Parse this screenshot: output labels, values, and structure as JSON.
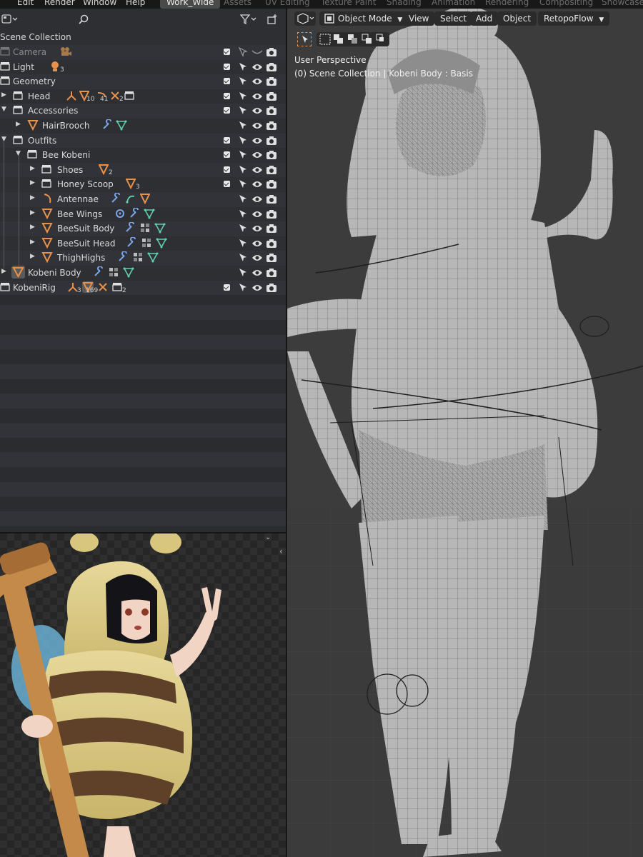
{
  "menubar": {
    "menus": [
      "Edit",
      "Render",
      "Window",
      "Help"
    ],
    "workspaces": [
      "Work_Wide",
      "Assets",
      "UV Editing",
      "Texture Paint",
      "Shading",
      "Animation",
      "Rendering",
      "Compositing",
      "Showcase"
    ],
    "active_workspace": "Work_Wide"
  },
  "outliner": {
    "root_label": "Scene Collection",
    "rows": [
      {
        "label": "Camera",
        "badge": ""
      },
      {
        "label": "Light",
        "badge": "3"
      },
      {
        "label": "Geometry",
        "badge": ""
      },
      {
        "label": "Head",
        "badge_a": "10",
        "badge_b": "41",
        "badge_c": "2"
      },
      {
        "label": "Accessories",
        "badge": ""
      },
      {
        "label": "HairBrooch",
        "badge": ""
      },
      {
        "label": "Outfits",
        "badge": ""
      },
      {
        "label": "Bee Kobeni",
        "badge": ""
      },
      {
        "label": "Shoes",
        "badge": "2"
      },
      {
        "label": "Honey Scoop",
        "badge": "3"
      },
      {
        "label": "Antennae",
        "badge": ""
      },
      {
        "label": "Bee Wings",
        "badge": ""
      },
      {
        "label": "BeeSuit Body",
        "badge": ""
      },
      {
        "label": "BeeSuit Head",
        "badge": ""
      },
      {
        "label": "ThighHighs",
        "badge": ""
      },
      {
        "label": "Kobeni Body",
        "badge": ""
      },
      {
        "label": "KobeniRig",
        "badge_a": "3",
        "badge_b": "169",
        "badge_c": "2"
      }
    ]
  },
  "viewport": {
    "mode_label": "Object Mode",
    "menus": [
      "View",
      "Select",
      "Add",
      "Object"
    ],
    "addon_label": "RetopoFlow",
    "perspective_label": "User Perspective",
    "context_label": "(0) Scene Collection | Kobeni Body : Basis"
  },
  "colors": {
    "accent_orange": "#e8914a",
    "modifier_blue": "#7aa6e6",
    "mesh_green": "#5fd1b0",
    "panel_bg": "#2e2f33"
  }
}
